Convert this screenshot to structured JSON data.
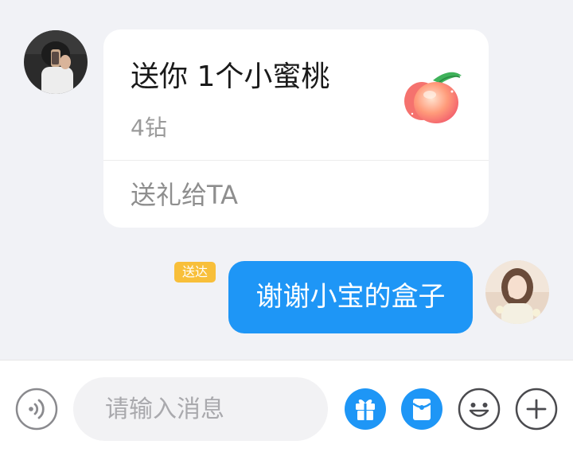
{
  "messages": {
    "incoming_gift": {
      "title": "送你 1个小蜜桃",
      "price": "4钻",
      "action_label": "送礼给TA",
      "gift_icon": "peach-icon"
    },
    "outgoing": {
      "text": "谢谢小宝的盒子",
      "status": "送达"
    }
  },
  "input_bar": {
    "placeholder": "请输入消息",
    "icons": [
      "voice-icon",
      "gift-icon",
      "red-packet-icon",
      "emoji-icon",
      "plus-icon"
    ]
  },
  "colors": {
    "background": "#f1f2f6",
    "bubble_out": "#1e96f6",
    "status_badge": "#f8bf3a",
    "accent_icon": "#1e96f6"
  }
}
